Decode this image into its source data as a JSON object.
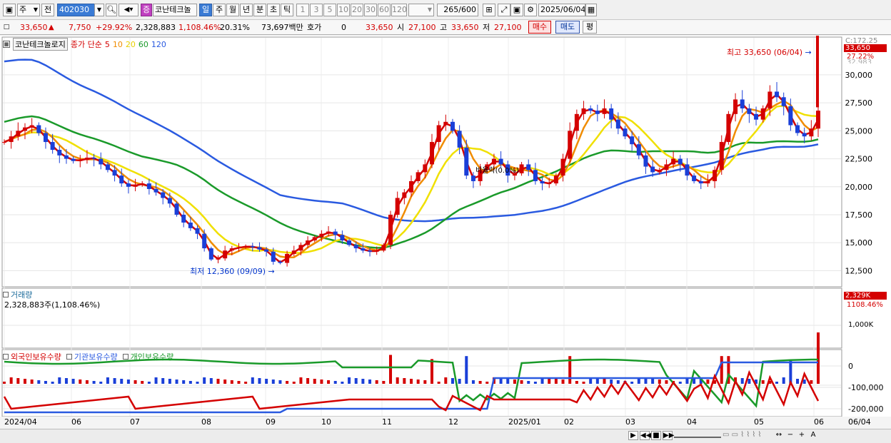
{
  "toolbar": {
    "market": "주",
    "prev": "전",
    "code": "402030",
    "name_button": "증",
    "stock_name": "코난테크놀",
    "periods": [
      "일",
      "주",
      "월",
      "년",
      "분",
      "초",
      "틱"
    ],
    "active_period": "일",
    "intervals": [
      "1",
      "3",
      "5",
      "10",
      "20",
      "30",
      "60",
      "120"
    ],
    "count_value": "265",
    "count_total": "/600",
    "date": "2025/06/04"
  },
  "quote": {
    "price": "33,650",
    "change": "7,750",
    "change_pct": "+29.92%",
    "volume": "2,328,883",
    "volume_pct": "1,108.46%",
    "turnover_pct": "20.31%",
    "amount": "73,697백만",
    "hoga_label": "호가",
    "hoga_value": "0",
    "hoga_price": "33,650",
    "open_label": "시",
    "open": "27,100",
    "high_label": "고",
    "high": "33,650",
    "low_label": "저",
    "low": "27,100",
    "buy_button": "매수",
    "sell_button": "매도",
    "eval_button": "평"
  },
  "price_panel": {
    "title": "코난테크놀로지",
    "indicator_label": "종가 단순",
    "ma_periods": [
      "5",
      "10",
      "20",
      "60",
      "120"
    ],
    "ma_colors": [
      "#d40000",
      "#f08c00",
      "#f0e000",
      "#1a9a2a",
      "#2a5ae0"
    ],
    "high_note": "최고 33,650 (06/04)",
    "low_note": "최저 12,360 (09/09)",
    "mid_note": "비율락(0.0%)",
    "right_top": "C:172.25",
    "right_price": "33,650",
    "right_pct": "27.22%",
    "right_partial": "32,983",
    "y_ticks": [
      "30,000",
      "27,500",
      "25,000",
      "22,500",
      "20,000",
      "17,500",
      "15,000",
      "12,500"
    ]
  },
  "volume_panel": {
    "title": "거래량",
    "value": "2,328,883주(1,108.46%)",
    "right_value": "2,329K",
    "right_pct": "1108.46%",
    "y_tick": "1,000K"
  },
  "holding_panel": {
    "series_labels": [
      "외국인보유수량",
      "기관보유수량",
      "개인보유수량"
    ],
    "series_colors": [
      "#d40000",
      "#2a5ae0",
      "#1a9a2a"
    ],
    "y_ticks": [
      "0",
      "-100,000",
      "-200,000"
    ]
  },
  "x_axis": {
    "labels": [
      "2024/04",
      "06",
      "07",
      "08",
      "09",
      "10",
      "11",
      "12",
      "2025/01",
      "02",
      "03",
      "04",
      "05",
      "06"
    ],
    "right_label": "06/04"
  },
  "chart_data": {
    "type": "candlestick",
    "y_axis_range": [
      11000,
      33500
    ],
    "moving_averages": [
      "5",
      "10",
      "20",
      "60",
      "120"
    ],
    "high": {
      "value": 33650,
      "date": "06/04"
    },
    "low": {
      "value": 12360,
      "date": "09/09"
    },
    "closes": [
      24000,
      24500,
      25000,
      25300,
      25500,
      24800,
      24000,
      23300,
      22800,
      22500,
      22300,
      22400,
      22600,
      22500,
      22000,
      21500,
      21000,
      20300,
      20000,
      20200,
      20300,
      19800,
      19500,
      19000,
      18500,
      17500,
      16800,
      16300,
      15800,
      14500,
      13500,
      13600,
      14300,
      14500,
      14600,
      14700,
      14600,
      14400,
      14200,
      13300,
      13200,
      14000,
      14300,
      14800,
      15200,
      15500,
      15800,
      16000,
      15700,
      15200,
      14800,
      14500,
      14300,
      14200,
      14300,
      14800,
      17500,
      19000,
      19500,
      20500,
      21300,
      22000,
      24000,
      25500,
      25800,
      25000,
      23500,
      21000,
      20500,
      21500,
      22000,
      22500,
      22000,
      21000,
      21200,
      22000,
      21500,
      20500,
      20300,
      20300,
      21000,
      22500,
      25000,
      26500,
      27000,
      26800,
      26500,
      27000,
      26000,
      25200,
      24500,
      23800,
      22800,
      21800,
      21300,
      21500,
      22000,
      22500,
      22000,
      21000,
      20500,
      20300,
      20500,
      21500,
      24000,
      26500,
      27800,
      27000,
      26500,
      26000,
      27000,
      28500,
      28000,
      27200,
      25500,
      24800,
      24500,
      25200,
      26800
    ]
  }
}
